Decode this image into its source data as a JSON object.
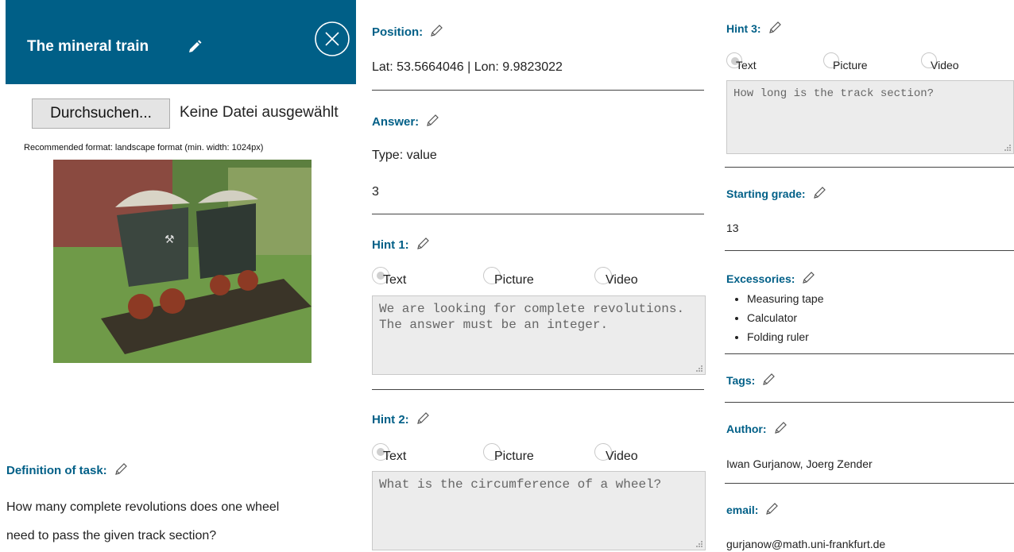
{
  "header": {
    "title": "The mineral train"
  },
  "file_upload": {
    "button_label": "Durchsuchen...",
    "status": "Keine Datei ausgewählt",
    "recommendation": "Recommended format: landscape format (min. width: 1024px)"
  },
  "definition": {
    "label": "Definition of task:",
    "text_line1": "How many complete revolutions does one wheel",
    "text_line2": "need to pass the given track section?"
  },
  "position": {
    "label": "Position:",
    "value": "Lat: 53.5664046 | Lon: 9.9823022"
  },
  "answer": {
    "label": "Answer:",
    "type": "Type: value",
    "value": "3"
  },
  "hint1": {
    "label": "Hint 1:",
    "options": [
      "Text",
      "Picture",
      "Video"
    ],
    "selected": "Text",
    "text": "We are looking for complete revolutions. The answer must be an integer."
  },
  "hint2": {
    "label": "Hint 2:",
    "options": [
      "Text",
      "Picture",
      "Video"
    ],
    "selected": "Text",
    "text": "What is the circumference of a wheel?"
  },
  "hint3": {
    "label": "Hint 3:",
    "options": [
      "Text",
      "Picture",
      "Video"
    ],
    "selected": "Text",
    "text": "How long is the track section?"
  },
  "starting_grade": {
    "label": "Starting grade:",
    "value": "13"
  },
  "excessories": {
    "label": "Excessories:",
    "items": [
      "Measuring tape",
      "Calculator",
      "Folding ruler"
    ]
  },
  "tags": {
    "label": "Tags:"
  },
  "author": {
    "label": "Author:",
    "value": "Iwan Gurjanow, Joerg Zender"
  },
  "email": {
    "label": "email:",
    "value": "gurjanow@math.uni-frankfurt.de"
  },
  "colors": {
    "header_bg": "#005f87",
    "label_blue": "#005f87",
    "textarea_bg": "#ececec"
  },
  "icons": [
    "pencil-icon",
    "close-circle-icon",
    "resize-grip-icon"
  ]
}
